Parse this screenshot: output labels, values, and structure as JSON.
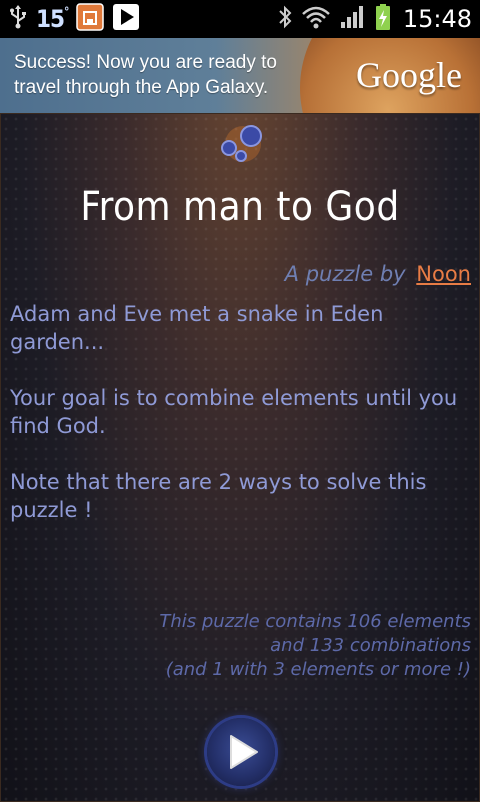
{
  "status_bar": {
    "temperature": "15",
    "temperature_unit": "°",
    "time": "15:48",
    "icons": [
      "usb-icon",
      "temperature-widget",
      "storage-icon",
      "play-store-icon",
      "bluetooth-icon",
      "wifi-icon",
      "signal-icon",
      "battery-charging-icon"
    ]
  },
  "ad": {
    "text": "Success! Now you are ready to travel through the App Galaxy.",
    "brand": "Google"
  },
  "puzzle": {
    "title": "From man to God",
    "byline_prefix": "A puzzle by",
    "author": "Noon",
    "paragraphs": [
      "Adam and Eve met a snake in Eden garden...",
      "Your goal is to combine elements until you find God.",
      "Note that there are 2 ways to solve this puzzle !"
    ],
    "stats": [
      "This puzzle contains 106 elements",
      "and 133 combinations",
      "(and 1 with 3 elements or more !)"
    ]
  },
  "colors": {
    "accent_link": "#e87c45",
    "text_primary": "#8f9ad6",
    "text_secondary": "#5d69a8"
  }
}
